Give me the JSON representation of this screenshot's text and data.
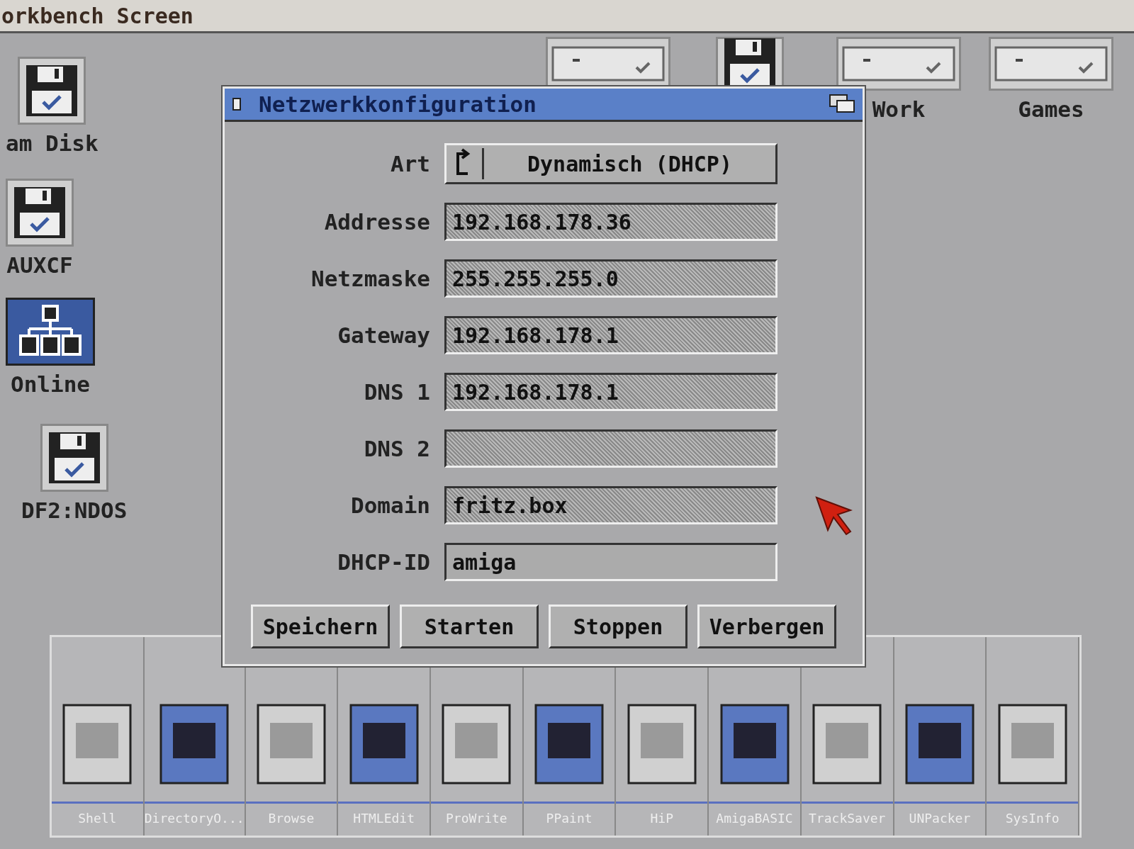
{
  "screen_title": "orkbench Screen",
  "desktop_icons": [
    {
      "label": "am Disk",
      "kind": "disk",
      "selected": false
    },
    {
      "label": "AUXCF",
      "kind": "disk",
      "selected": false
    },
    {
      "label": "Online",
      "kind": "network",
      "selected": true
    },
    {
      "label": "DF2:NDOS",
      "kind": "disk",
      "selected": false
    }
  ],
  "top_icons": [
    {
      "kind": "drive"
    },
    {
      "kind": "disk"
    },
    {
      "kind": "drive",
      "label": "Work"
    },
    {
      "kind": "drive",
      "label": "Games"
    }
  ],
  "window": {
    "title": "Netzwerkkonfiguration",
    "fields": [
      {
        "label": "Art",
        "kind": "cycle",
        "value": "Dynamisch (DHCP)"
      },
      {
        "label": "Addresse",
        "kind": "text",
        "value": "192.168.178.36",
        "disabled": true
      },
      {
        "label": "Netzmaske",
        "kind": "text",
        "value": "255.255.255.0",
        "disabled": true
      },
      {
        "label": "Gateway",
        "kind": "text",
        "value": "192.168.178.1",
        "disabled": true
      },
      {
        "label": "DNS 1",
        "kind": "text",
        "value": "192.168.178.1",
        "disabled": true
      },
      {
        "label": "DNS 2",
        "kind": "text",
        "disabled": true
      },
      {
        "label": "Domain",
        "kind": "text",
        "value": "fritz.box",
        "disabled": true
      },
      {
        "label": "DHCP-ID",
        "kind": "text",
        "value": "amiga",
        "disabled": false
      }
    ],
    "buttons": [
      "Speichern",
      "Starten",
      "Stoppen",
      "Verbergen"
    ]
  },
  "dock": [
    {
      "label": "Shell"
    },
    {
      "label": "DirectoryO..."
    },
    {
      "label": "Browse"
    },
    {
      "label": "HTMLEdit"
    },
    {
      "label": "ProWrite"
    },
    {
      "label": "PPaint"
    },
    {
      "label": "HiP"
    },
    {
      "label": "AmigaBASIC"
    },
    {
      "label": "TrackSaver"
    },
    {
      "label": "UNPacker"
    },
    {
      "label": "SysInfo"
    }
  ]
}
